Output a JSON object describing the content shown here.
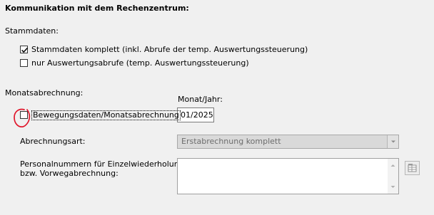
{
  "section_title": "Kommunikation mit dem Rechenzentrum:",
  "stammdaten": {
    "label": "Stammdaten:",
    "option_complete": {
      "label": "Stammdaten komplett (inkl. Abrufe der temp. Auswertungssteuerung)",
      "checked": true
    },
    "option_eval_only": {
      "label": "nur Auswertungsabrufe (temp. Auswertungssteuerung)",
      "checked": false
    }
  },
  "monatsabrechnung": {
    "label": "Monatsabrechnung:",
    "month_year_label": "Monat/Jahr:",
    "month_year_value": "01/2025",
    "movement_data": {
      "label": "Bewegungsdaten/Monatsabrechnung",
      "checked": false
    },
    "billing_type_label": "Abrechnungsart:",
    "billing_type_value": "Erstabrechnung komplett",
    "personnel_label_line1": "Personalnummern für Einzelwiederholung",
    "personnel_label_line2": "bzw. Vorwegabrechnung:",
    "personnel_value": ""
  },
  "annotation_color": "#e0162b"
}
